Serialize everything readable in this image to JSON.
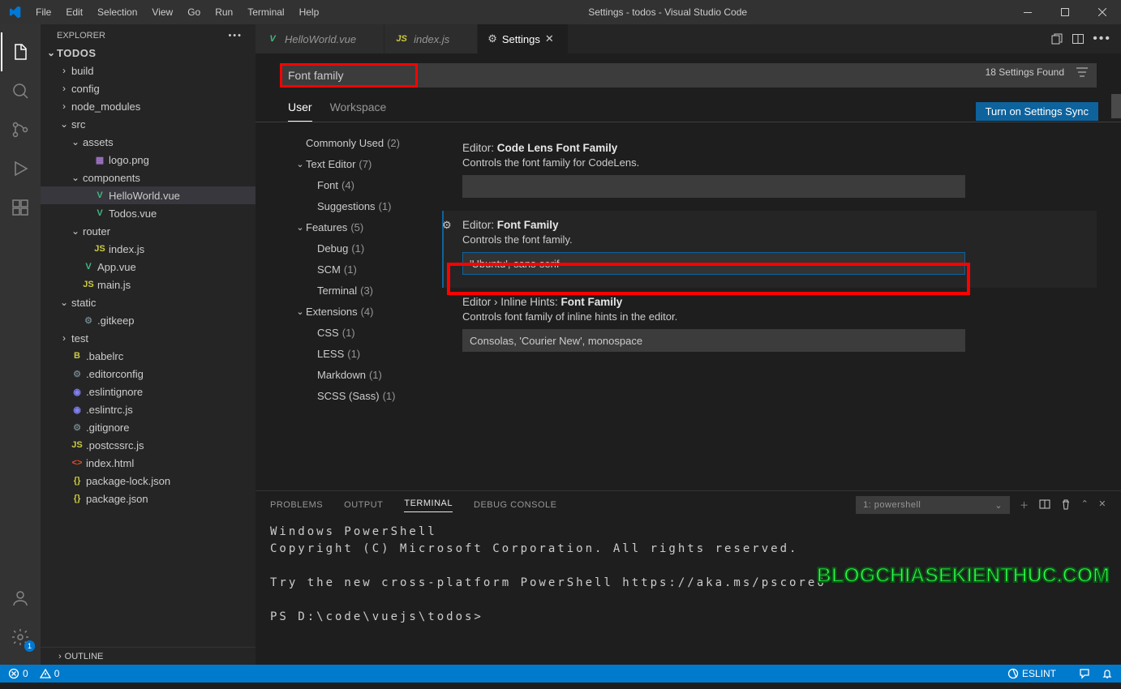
{
  "titlebar": {
    "title": "Settings - todos - Visual Studio Code"
  },
  "menu": [
    "File",
    "Edit",
    "Selection",
    "View",
    "Go",
    "Run",
    "Terminal",
    "Help"
  ],
  "sidebar": {
    "title": "EXPLORER",
    "root": "TODOS",
    "outline": "OUTLINE",
    "tree": [
      {
        "d": 1,
        "t": "folder",
        "open": false,
        "label": "build"
      },
      {
        "d": 1,
        "t": "folder",
        "open": false,
        "label": "config"
      },
      {
        "d": 1,
        "t": "folder",
        "open": false,
        "label": "node_modules"
      },
      {
        "d": 1,
        "t": "folder",
        "open": true,
        "label": "src"
      },
      {
        "d": 2,
        "t": "folder",
        "open": true,
        "label": "assets"
      },
      {
        "d": 3,
        "t": "file",
        "icon": "img",
        "label": "logo.png"
      },
      {
        "d": 2,
        "t": "folder",
        "open": true,
        "label": "components"
      },
      {
        "d": 3,
        "t": "file",
        "icon": "vue",
        "label": "HelloWorld.vue",
        "selected": true
      },
      {
        "d": 3,
        "t": "file",
        "icon": "vue",
        "label": "Todos.vue"
      },
      {
        "d": 2,
        "t": "folder",
        "open": true,
        "label": "router"
      },
      {
        "d": 3,
        "t": "file",
        "icon": "js",
        "label": "index.js"
      },
      {
        "d": 2,
        "t": "file",
        "icon": "vue",
        "label": "App.vue"
      },
      {
        "d": 2,
        "t": "file",
        "icon": "js",
        "label": "main.js"
      },
      {
        "d": 1,
        "t": "folder",
        "open": true,
        "label": "static"
      },
      {
        "d": 2,
        "t": "file",
        "icon": "gear",
        "label": ".gitkeep"
      },
      {
        "d": 1,
        "t": "folder",
        "open": false,
        "label": "test"
      },
      {
        "d": 1,
        "t": "file",
        "icon": "babel",
        "label": ".babelrc"
      },
      {
        "d": 1,
        "t": "file",
        "icon": "gear",
        "label": ".editorconfig"
      },
      {
        "d": 1,
        "t": "file",
        "icon": "eslint",
        "label": ".eslintignore"
      },
      {
        "d": 1,
        "t": "file",
        "icon": "eslint",
        "label": ".eslintrc.js"
      },
      {
        "d": 1,
        "t": "file",
        "icon": "gear",
        "label": ".gitignore"
      },
      {
        "d": 1,
        "t": "file",
        "icon": "js",
        "label": ".postcssrc.js"
      },
      {
        "d": 1,
        "t": "file",
        "icon": "html",
        "label": "index.html"
      },
      {
        "d": 1,
        "t": "file",
        "icon": "json",
        "label": "package-lock.json"
      },
      {
        "d": 1,
        "t": "file",
        "icon": "json",
        "label": "package.json"
      }
    ]
  },
  "tabs": [
    {
      "icon": "vue",
      "label": "HelloWorld.vue",
      "active": false
    },
    {
      "icon": "js",
      "label": "index.js",
      "active": false
    },
    {
      "icon": "settings",
      "label": "Settings",
      "active": true
    }
  ],
  "settings": {
    "search": "Font family",
    "found": "18 Settings Found",
    "sync": "Turn on Settings Sync",
    "nav": [
      "User",
      "Workspace"
    ],
    "activeNav": 0,
    "tree": [
      {
        "d": 0,
        "chev": "",
        "label": "Commonly Used",
        "count": "(2)"
      },
      {
        "d": 0,
        "chev": "v",
        "label": "Text Editor",
        "count": "(7)"
      },
      {
        "d": 1,
        "chev": "",
        "label": "Font",
        "count": "(4)"
      },
      {
        "d": 1,
        "chev": "",
        "label": "Suggestions",
        "count": "(1)"
      },
      {
        "d": 0,
        "chev": "v",
        "label": "Features",
        "count": "(5)"
      },
      {
        "d": 1,
        "chev": "",
        "label": "Debug",
        "count": "(1)"
      },
      {
        "d": 1,
        "chev": "",
        "label": "SCM",
        "count": "(1)"
      },
      {
        "d": 1,
        "chev": "",
        "label": "Terminal",
        "count": "(3)"
      },
      {
        "d": 0,
        "chev": "v",
        "label": "Extensions",
        "count": "(4)"
      },
      {
        "d": 1,
        "chev": "",
        "label": "CSS",
        "count": "(1)"
      },
      {
        "d": 1,
        "chev": "",
        "label": "LESS",
        "count": "(1)"
      },
      {
        "d": 1,
        "chev": "",
        "label": "Markdown",
        "count": "(1)"
      },
      {
        "d": 1,
        "chev": "",
        "label": "SCSS (Sass)",
        "count": "(1)"
      }
    ],
    "items": [
      {
        "scope": "Editor:",
        "name": "Code Lens Font Family",
        "desc": "Controls the font family for CodeLens.",
        "value": "",
        "focused": false
      },
      {
        "scope": "Editor:",
        "name": "Font Family",
        "desc": "Controls the font family.",
        "value": "'Ubuntu', sans-serif",
        "focused": true
      },
      {
        "scope": "Editor › Inline Hints:",
        "name": "Font Family",
        "desc": "Controls font family of inline hints in the editor.",
        "value": "Consolas, 'Courier New', monospace",
        "focused": false
      }
    ]
  },
  "panel": {
    "tabs": [
      "PROBLEMS",
      "OUTPUT",
      "TERMINAL",
      "DEBUG CONSOLE"
    ],
    "active": 2,
    "select": "1: powershell",
    "lines": [
      "Windows PowerShell",
      "Copyright (C) Microsoft Corporation. All rights reserved.",
      "",
      "Try the new cross-platform PowerShell https://aka.ms/pscore6",
      "",
      "PS D:\\code\\vuejs\\todos>"
    ]
  },
  "statusbar": {
    "errors": "0",
    "warnings": "0",
    "eslint": "ESLINT"
  },
  "gearBadge": "1",
  "watermark": "BLOGCHIASEKIENTHUC.COM"
}
